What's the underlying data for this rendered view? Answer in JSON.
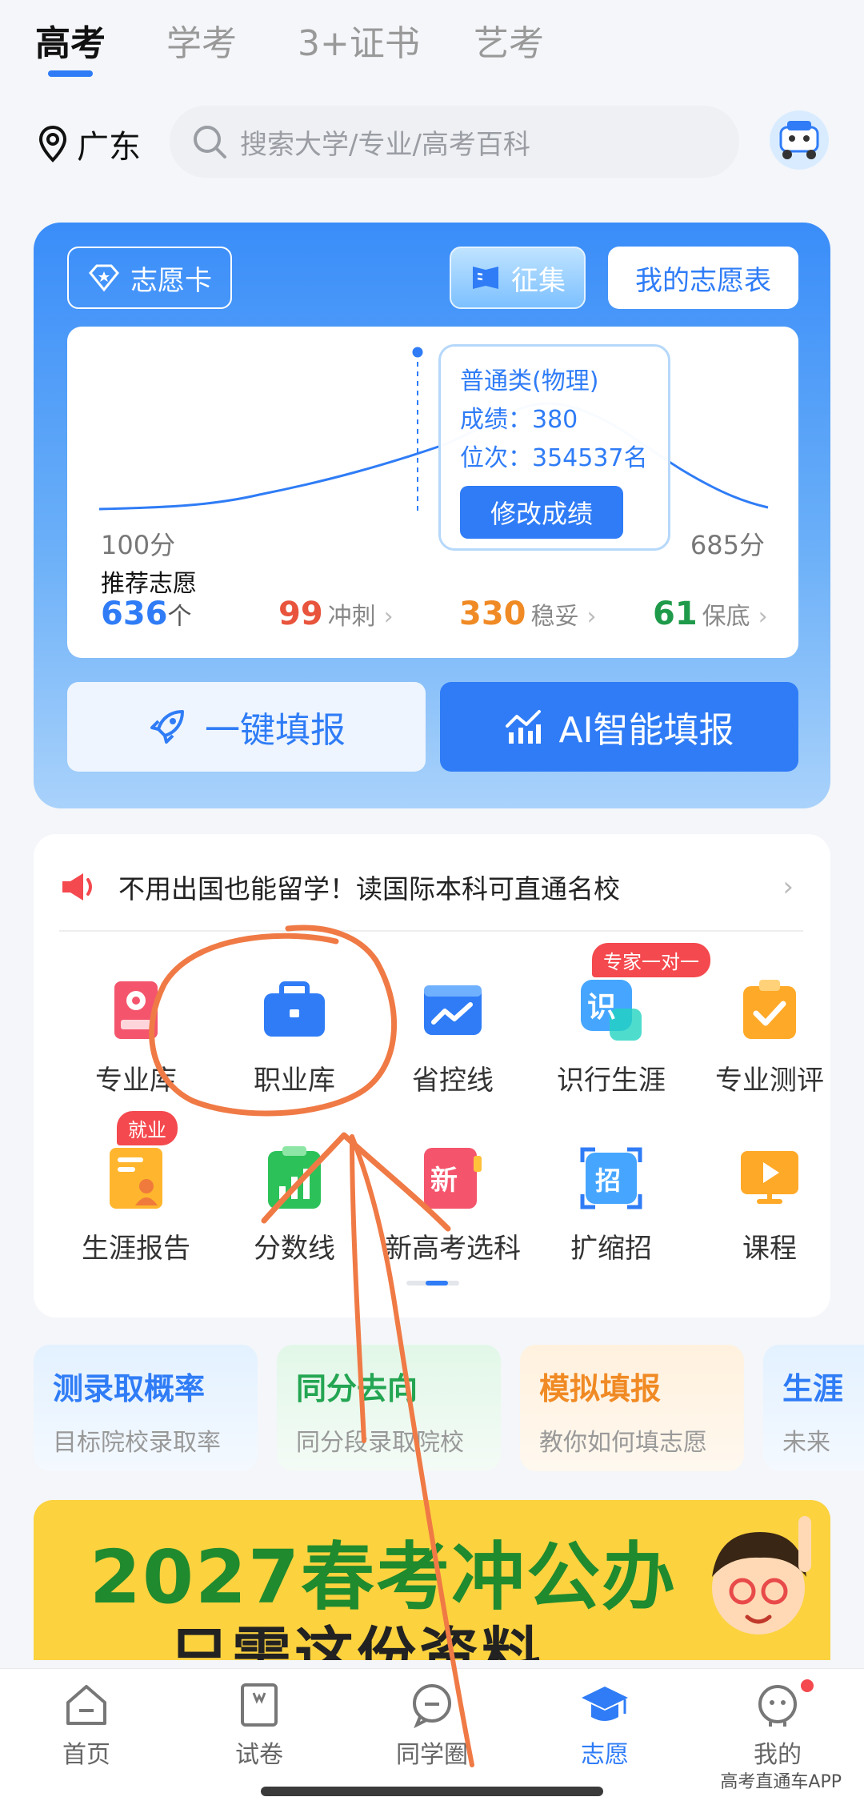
{
  "top_tabs": [
    {
      "label": "高考",
      "active": true
    },
    {
      "label": "学考",
      "active": false
    },
    {
      "label": "3+证书",
      "active": false
    },
    {
      "label": "艺考",
      "active": false
    }
  ],
  "location": "广东",
  "search": {
    "placeholder": "搜索大学/专业/高考百科"
  },
  "volunteer_card": {
    "card_label": "志愿卡",
    "collect_label": "征集",
    "my_table_label": "我的志愿表",
    "chart": {
      "min_label": "100分",
      "max_label": "685分"
    },
    "tooltip": {
      "category": "普通类(物理)",
      "score": "成绩：380",
      "rank": "位次：354537名",
      "edit_button": "修改成绩"
    },
    "recommend": {
      "label": "推荐志愿",
      "count": "636",
      "count_unit": "个",
      "reach": {
        "value": "99",
        "label": "冲刺"
      },
      "steady": {
        "value": "330",
        "label": "稳妥"
      },
      "safe": {
        "value": "61",
        "label": "保底"
      }
    },
    "one_key_button": "一键填报",
    "ai_button": "AI智能填报"
  },
  "notice": "不用出国也能留学！读国际本科可直通名校",
  "grid": [
    {
      "label": "专业库",
      "icon": "major-library-icon"
    },
    {
      "label": "职业库",
      "icon": "career-library-icon"
    },
    {
      "label": "省控线",
      "icon": "provincial-line-icon"
    },
    {
      "label": "识行生涯",
      "icon": "career-path-icon",
      "badge": "专家一对一"
    },
    {
      "label": "专业测评",
      "icon": "major-test-icon"
    },
    {
      "label": "生涯报告",
      "icon": "career-report-icon",
      "badge": "就业"
    },
    {
      "label": "分数线",
      "icon": "score-line-icon"
    },
    {
      "label": "新高考选科",
      "icon": "subject-select-icon"
    },
    {
      "label": "扩缩招",
      "icon": "enrollment-change-icon"
    },
    {
      "label": "课程",
      "icon": "course-icon"
    }
  ],
  "features": [
    {
      "title": "测录取概率",
      "subtitle": "目标院校录取率"
    },
    {
      "title": "同分去向",
      "subtitle": "同分段录取院校"
    },
    {
      "title": "模拟填报",
      "subtitle": "教你如何填志愿"
    },
    {
      "title": "生涯",
      "subtitle": "未来"
    }
  ],
  "banner": {
    "title": "2027春考冲公办",
    "subtitle": "只需这份资料"
  },
  "bottom_nav": [
    {
      "label": "首页",
      "active": false
    },
    {
      "label": "试卷",
      "active": false
    },
    {
      "label": "同学圈",
      "active": false
    },
    {
      "label": "志愿",
      "active": true
    },
    {
      "label": "我的",
      "active": false
    }
  ],
  "watermark": "高考直通车APP",
  "colors": {
    "accent": "#2f7cf6",
    "reach": "#e8543c",
    "steady": "#f08a24",
    "safe": "#1f9a4a",
    "annotation": "#f07a45"
  }
}
